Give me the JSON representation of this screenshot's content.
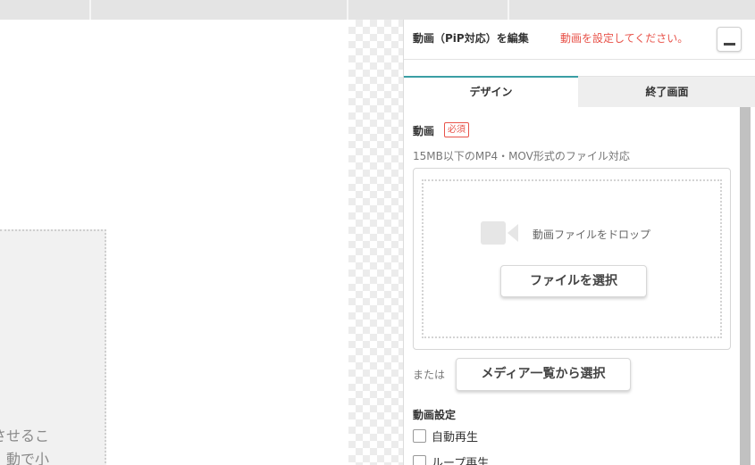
{
  "canvas": {
    "fragment_line1": "させるこ",
    "fragment_line2": "動で小"
  },
  "panel": {
    "title": "動画（PiP対応）を編集",
    "warning": "動画を設定してください。",
    "minimize_icon": "minimize-icon",
    "tabs": [
      {
        "label": "デザイン",
        "active": true
      },
      {
        "label": "終了画面",
        "active": false
      }
    ],
    "video_section": {
      "label": "動画",
      "required_badge": "必須",
      "hint": "15MB以下のMP4・MOV形式のファイル対応",
      "drop_icon": "video-camera-icon",
      "drop_text": "動画ファイルをドロップ",
      "select_file_button": "ファイルを選択",
      "or_text": "または",
      "media_list_button": "メディア一覧から選択"
    },
    "settings": {
      "label": "動画設定",
      "options": [
        {
          "label": "自動再生",
          "checked": false
        },
        {
          "label": "ループ再生",
          "checked": false
        }
      ]
    }
  },
  "colors": {
    "accent": "#3a9ea4",
    "warning": "#e8534a"
  }
}
